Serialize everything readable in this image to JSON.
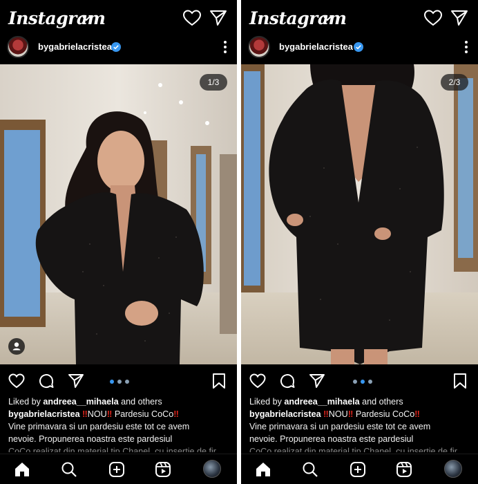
{
  "app_name": "Instagram",
  "colors": {
    "background": "#000000",
    "text": "#ffffff",
    "verified": "#3897f0",
    "accent_red": "#e0261d"
  },
  "icons": {
    "logo_dropdown": "chevron-down-icon",
    "notifications": "heart-icon",
    "messages": "paper-plane-icon",
    "more": "vertical-dots-icon",
    "like": "heart-icon",
    "comment": "comment-bubble-icon",
    "share": "paper-plane-icon",
    "save": "bookmark-icon",
    "tags": "person-icon",
    "home": "home-icon",
    "search": "search-icon",
    "create": "plus-square-icon",
    "reels": "reels-icon"
  },
  "posts": [
    {
      "username": "bygabrielacristea",
      "carousel_counter": "1/3",
      "liked_by_prefix": "Liked by ",
      "liked_by_user": "andreea__mihaela",
      "liked_by_suffix": " and others",
      "caption_user": "bygabrielacristea",
      "caption_bang": "‼",
      "caption_nou": "NOU",
      "caption_title": " Pardesiu CoCo",
      "caption_line2": "Vine primavara si un pardesiu este tot ce avem",
      "caption_line3": "nevoie. Propunerea noastra este pardesiul",
      "caption_line4": "CoCo realizat din material tip Chanel, cu insertie de fir"
    },
    {
      "username": "bygabrielacristea",
      "carousel_counter": "2/3",
      "liked_by_prefix": "Liked by ",
      "liked_by_user": "andreea__mihaela",
      "liked_by_suffix": " and others",
      "caption_user": "bygabrielacristea",
      "caption_bang": "‼",
      "caption_nou": "NOU",
      "caption_title": " Pardesiu CoCo",
      "caption_line2": "Vine primavara si un pardesiu este tot ce avem",
      "caption_line3": "nevoie. Propunerea noastra este pardesiul",
      "caption_line4": "CoCo realizat din material tip Chanel, cu insertie de fir"
    }
  ]
}
